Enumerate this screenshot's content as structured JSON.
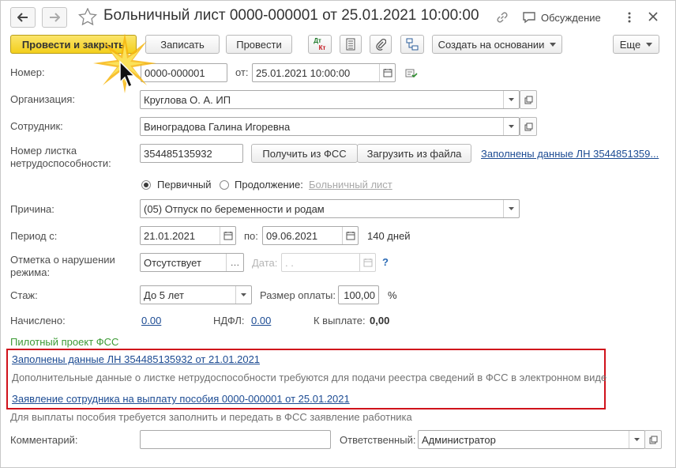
{
  "header": {
    "title": "Больничный лист 0000-000001 от 25.01.2021 10:00:00",
    "discussion_label": "Обсуждение"
  },
  "toolbar": {
    "post_close_label": "Провести и закрыть",
    "save_label": "Записать",
    "post_label": "Провести",
    "dt_label": "Дт",
    "kt_label": "Кт",
    "create_based_label": "Создать на основании",
    "more_label": "Еще"
  },
  "form": {
    "number_label": "Номер:",
    "number_value": "0000-000001",
    "from_label": "от:",
    "date_value": "25.01.2021 10:00:00",
    "org_label": "Организация:",
    "org_value": "Круглова О. А. ИП",
    "employee_label": "Сотрудник:",
    "employee_value": "Виноградова Галина Игоревна",
    "sheet_label_1": "Номер листка",
    "sheet_label_2": "нетрудоспособности:",
    "sheet_value": "354485135932",
    "get_fss_label": "Получить из ФСС",
    "load_file_label": "Загрузить из файла",
    "filled_link": "Заполнены данные ЛН 3544851359...",
    "primary_label": "Первичный",
    "continuation_label": "Продолжение:",
    "sick_list_link": "Больничный лист",
    "reason_label": "Причина:",
    "reason_value": "(05) Отпуск по беременности и родам",
    "period_label": "Период с:",
    "period_from": "21.01.2021",
    "period_to_label": "по:",
    "period_to": "09.06.2021",
    "days_value": "140 дней",
    "violation_label_1": "Отметка о нарушении",
    "violation_label_2": "режима:",
    "violation_value": "Отсутствует",
    "violation_date_label": "Дата:",
    "violation_date_value": " .  .",
    "help_mark": "?",
    "experience_label": "Стаж:",
    "experience_value": "До 5 лет",
    "pay_size_label": "Размер оплаты:",
    "pay_size_value": "100,00",
    "percent": "%",
    "accrued_label": "Начислено:",
    "accrued_value": "0.00",
    "ndfl_label": "НДФЛ:",
    "ndfl_value": "0.00",
    "payout_label": "К выплате:",
    "payout_value": "0,00"
  },
  "fss": {
    "pilot_label": "Пилотный проект ФСС",
    "filled_ln_link": "Заполнены данные ЛН 354485135932 от 21.01.2021",
    "additional_text": "Дополнительные данные о листке нетрудоспособности требуются для подачи реестра сведений в ФСС в электронном виде",
    "application_link": "Заявление сотрудника на выплату пособия 0000-000001 от 25.01.2021",
    "payment_note": "Для выплаты пособия требуется заполнить и передать в ФСС заявление работника"
  },
  "footer": {
    "comment_label": "Комментарий:",
    "comment_value": "",
    "responsible_label": "Ответственный:",
    "responsible_value": "Администратор"
  },
  "colors": {
    "primary_button": "#f3cf1c",
    "link": "#1c4b93",
    "pilot_green": "#3c9a35",
    "highlight_red": "#d0121b"
  }
}
